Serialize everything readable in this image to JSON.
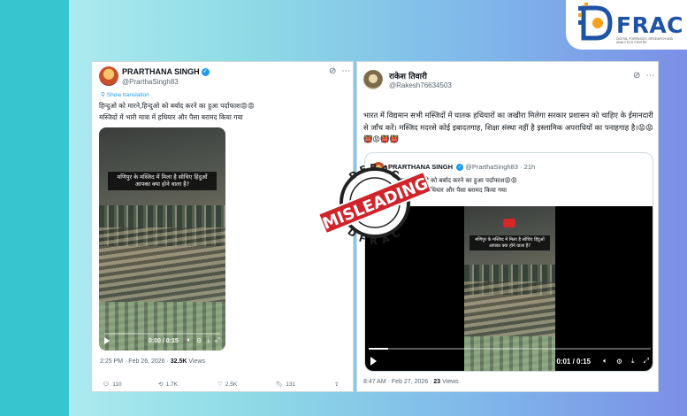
{
  "brand": {
    "name": "FRAC",
    "tagline": "DIGITAL FORENSICS, RESEARCH AND ANALYTICS CENTRE"
  },
  "left_tweet": {
    "author_name": "PRARTHANA SINGH",
    "handle": "@PrarthaSingh83",
    "show_translation": "Show translation",
    "text_line1": "हिन्दुओ को मारने,हिन्दुओ को बर्बाद करने का हुआ पर्दाफाश😡😡",
    "text_line2": "मस्जिदों में भारी मात्रा में हथियार और पैसा बरामद किया गया",
    "video_caption": "मणिपुर के मस्जिद में मिला है सोचिए हिंदुओं आपका क्या होने वाला है?",
    "video_time": "0:00 / 0:15",
    "video_progress": 0.0,
    "timestamp": "2:25 PM · Feb 26, 2026 · ",
    "views_count": "32.5K",
    "views_label": "Views",
    "actions": {
      "replies": "110",
      "reposts": "1.7K",
      "likes": "2.5K",
      "bookmarks": "131"
    }
  },
  "right_tweet": {
    "author_name": "राकेश तिवारी",
    "handle": "@Rakesh76634503",
    "text": "भारत में विद्यमान सभी मस्जिदों में घातक हथियारों का जखीरा मिलेगा सरकार प्रशासन को चाहिए के ईमानदारी से जाँच करें। मस्जिद मदरसे कोई इबादतगाह, शिक्षा संस्था नहीं है इस्लामिक अपराधियों का पनाहगाह है।😡😡👹😡👹👹",
    "quoted": {
      "author_name": "PRARTHANA SINGH",
      "handle": "@PrarthaSingh83",
      "age": "21h",
      "text_line1": "हिन्दुओ को मारने,हिन्दुओ को बर्बाद करने का हुआ पर्दाफाश😡😡",
      "text_line2": "मस्जिदों में भारी मात्रा में हथियार और पैसा बरामद किया गया",
      "video_caption": "मणिपुर के मस्जिद में मिला है सोचिए हिंदुओं आपका क्या होने वाला है?",
      "video_time": "0:01 / 0:15",
      "video_progress": 0.07
    },
    "timestamp": "8:47 AM · Feb 27, 2026 · ",
    "views_count": "23",
    "views_label": "Views"
  },
  "stamp": {
    "top": "DFRAC",
    "label": "MISLEADING",
    "bottom": "DFRAC"
  },
  "colors": {
    "stamp_red": "#d0232b",
    "x_blue": "#1d9bf0",
    "brand_blue": "#1f53a4"
  }
}
